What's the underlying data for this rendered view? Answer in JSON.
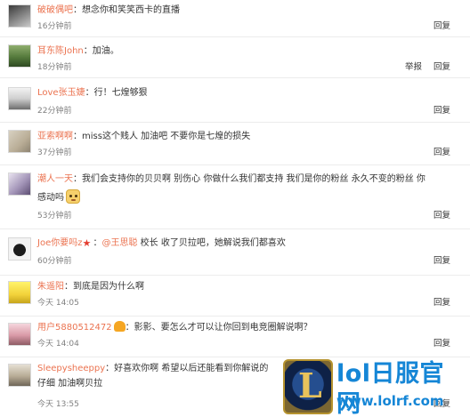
{
  "comments": [
    {
      "username": "破破偶吧",
      "text": "想念你和笑笑西卡的直播",
      "time": "16分钟前",
      "actions": {
        "reply": "回复"
      }
    },
    {
      "username": "耳东陈John",
      "text": "加油。",
      "time": "18分钟前",
      "actions": {
        "report": "举报",
        "reply": "回复"
      }
    },
    {
      "username": "Love张玉婕",
      "text": "行！七煌够狠",
      "time": "22分钟前",
      "actions": {
        "reply": "回复"
      }
    },
    {
      "username": "亚索啊啊",
      "text": "miss这个贱人 加油吧 不要你是七煌的损失",
      "time": "37分钟前",
      "actions": {
        "reply": "回复"
      }
    },
    {
      "username": "潮人一天",
      "text": "我们会支持你的贝贝啊 别伤心 你做什么我们都支持 我们是你的粉丝 永久不变的粉丝 你",
      "text_line2": "感动吗",
      "time": "53分钟前",
      "actions": {
        "reply": "回复"
      },
      "icons": [
        "dog-emoji-icon"
      ]
    },
    {
      "username": "Joe你要吗z",
      "mention": "@王思聪",
      "text": "校长 收了贝拉吧，她解说我们都喜欢",
      "time": "60分钟前",
      "actions": {
        "reply": "回复"
      },
      "icons": [
        "star-badge-icon"
      ]
    },
    {
      "username": "朱遥阳",
      "text": "到底是因为什么啊",
      "time": "今天 14:05",
      "actions": {
        "reply": "回复"
      }
    },
    {
      "username": "用户5880512472",
      "text": "影影、要怎么才可以让你回到电竞圈解说啊？",
      "time": "今天 14:04",
      "actions": {
        "reply": "回复"
      },
      "icons": [
        "hand-badge-icon"
      ]
    },
    {
      "username": "Sleepysheeppy",
      "text": "好喜欢你啊 希望以后还能看到你解说的",
      "text_line2": "仔细 加油啊贝拉",
      "time": "今天 13:55",
      "actions": {
        "reply": "回复"
      }
    }
  ],
  "separator": "：",
  "watermark": {
    "logo_letter": "L",
    "title": "lol日服官网",
    "url": "www.lolrf.com"
  }
}
